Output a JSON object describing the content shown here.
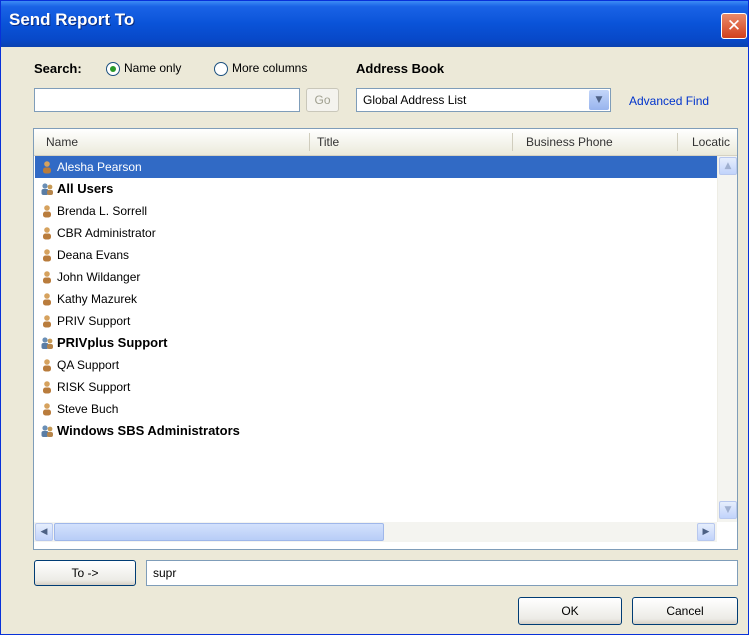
{
  "window": {
    "title": "Send Report To"
  },
  "search": {
    "label": "Search:",
    "option_name_only": "Name only",
    "option_more_columns": "More columns",
    "selected": "Name only",
    "value": "",
    "go_label": "Go"
  },
  "address_book": {
    "label": "Address Book",
    "selected": "Global Address List",
    "advanced_find": "Advanced Find"
  },
  "columns": [
    "Name",
    "Title",
    "Business Phone",
    "Locatic"
  ],
  "entries": [
    {
      "name": "Alesha Pearson",
      "type": "user",
      "selected": true
    },
    {
      "name": "All Users",
      "type": "group",
      "selected": false
    },
    {
      "name": "Brenda L. Sorrell",
      "type": "user",
      "selected": false
    },
    {
      "name": "CBR Administrator",
      "type": "user",
      "selected": false
    },
    {
      "name": "Deana Evans",
      "type": "user",
      "selected": false
    },
    {
      "name": "John Wildanger",
      "type": "user",
      "selected": false
    },
    {
      "name": "Kathy Mazurek",
      "type": "user",
      "selected": false
    },
    {
      "name": "PRIV Support",
      "type": "user",
      "selected": false
    },
    {
      "name": "PRIVplus Support",
      "type": "group",
      "selected": false
    },
    {
      "name": "QA Support",
      "type": "user",
      "selected": false
    },
    {
      "name": "RISK Support",
      "type": "user",
      "selected": false
    },
    {
      "name": "Steve Buch",
      "type": "user",
      "selected": false
    },
    {
      "name": "Windows SBS Administrators",
      "type": "group",
      "selected": false
    }
  ],
  "to": {
    "button_label": "To ->",
    "value": "supr"
  },
  "buttons": {
    "ok": "OK",
    "cancel": "Cancel"
  },
  "icons": {
    "close": "close-icon",
    "user": "user-icon",
    "group": "group-icon",
    "dropdown": "chevron-down-icon"
  },
  "colors": {
    "titlebar": "#0a53d8",
    "selection": "#316ac5",
    "link": "#0033cc",
    "dialog_bg": "#ece9d8"
  }
}
